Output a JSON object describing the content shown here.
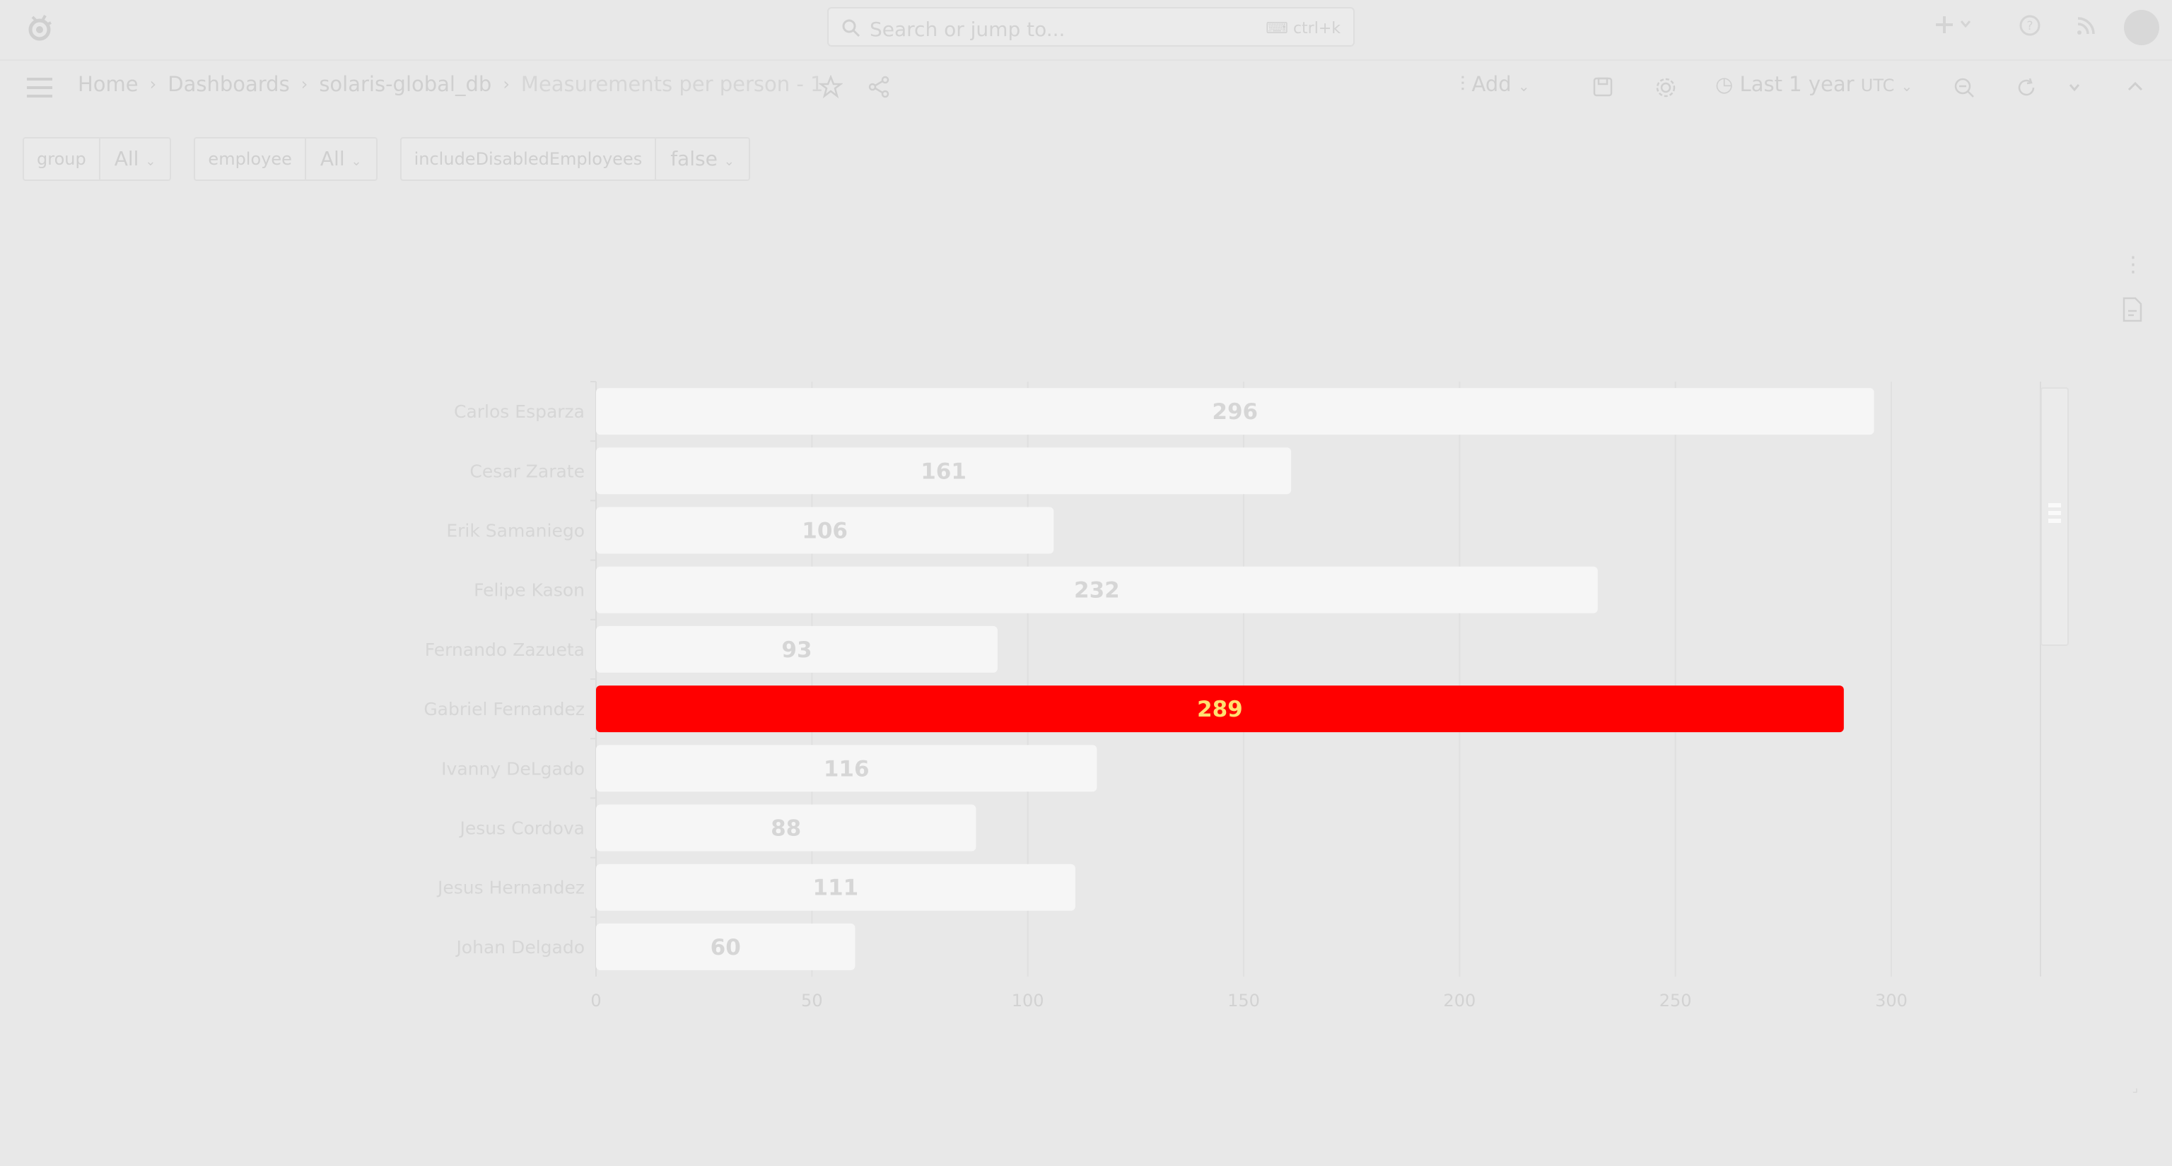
{
  "topbar": {
    "search_placeholder": "Search or jump to...",
    "search_shortcut": "ctrl+k",
    "icons": [
      "grafana-logo-icon",
      "search-icon",
      "keyboard-icon",
      "plus-icon",
      "chevron-down-icon",
      "help-icon",
      "rss-icon",
      "avatar"
    ]
  },
  "breadcrumb": {
    "items": [
      "Home",
      "Dashboards",
      "solaris-global_db",
      "Measurements per person - 1"
    ]
  },
  "toolbar": {
    "add_label": "Add",
    "time_range": "Last 1 year",
    "timezone": "UTC"
  },
  "variables": [
    {
      "label": "group",
      "value": "All"
    },
    {
      "label": "employee",
      "value": "All"
    },
    {
      "label": "includeDisabledEmployees",
      "value": "false"
    }
  ],
  "colors": {
    "background": "#e8e8e8",
    "bar": "#f6f6f6",
    "highlight_bar": "#ff0000",
    "highlight_label": "#ffe070"
  },
  "chart_data": {
    "type": "bar",
    "orientation": "horizontal",
    "categories": [
      "Carlos Esparza",
      "Cesar Zarate",
      "Erik Samaniego",
      "Felipe Kason",
      "Fernando Zazueta",
      "Gabriel Fernandez",
      "Ivanny DeLgado",
      "Jesus Cordova",
      "Jesus Hernandez",
      "Johan Delgado"
    ],
    "values": [
      296,
      161,
      106,
      232,
      93,
      289,
      116,
      88,
      111,
      60
    ],
    "highlighted_index": 5,
    "xlim": [
      0,
      300
    ],
    "xticks": [
      0,
      50,
      100,
      150,
      200,
      250,
      300
    ],
    "grid": true
  }
}
